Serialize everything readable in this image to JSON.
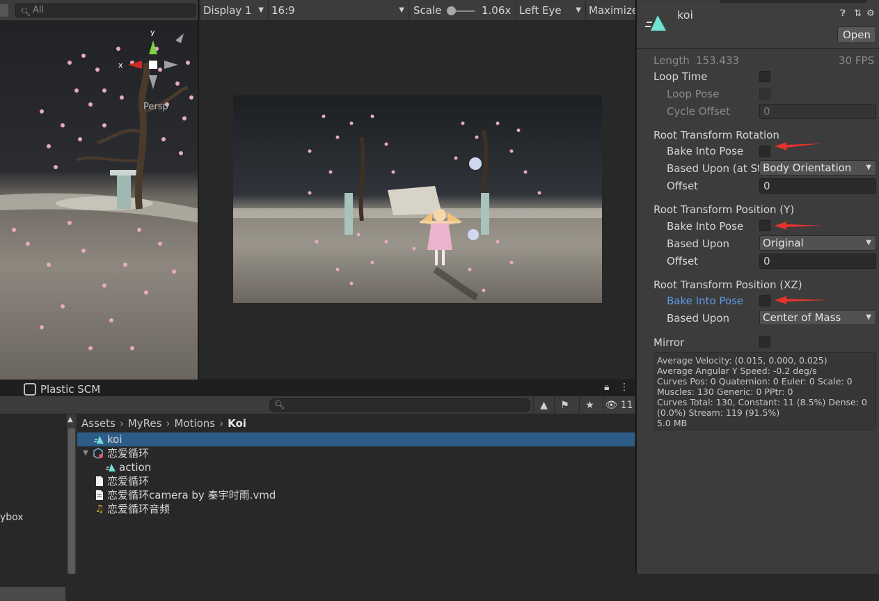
{
  "scene": {
    "search_placeholder": "All",
    "gizmo": {
      "x_label": "x",
      "y_label": "y",
      "persp_label": "Persp"
    }
  },
  "game": {
    "display": "Display 1",
    "aspect": "16:9",
    "scale_label": "Scale",
    "scale_value": "1.06x",
    "eye": "Left Eye",
    "maximize": "Maximize"
  },
  "project": {
    "tab_label": "Plastic SCM",
    "hidden_count": "11",
    "breadcrumb": [
      "Assets",
      "MyRes",
      "Motions",
      "Koi"
    ],
    "tree_items": [
      "ybox"
    ],
    "files": [
      {
        "label": "koi",
        "icon": "animation-clip-icon",
        "selected": true
      },
      {
        "label": "恋爱循环",
        "icon": "model-prefab-icon",
        "selected": false
      },
      {
        "label": "action",
        "icon": "animation-clip-icon",
        "selected": false
      },
      {
        "label": "恋爱循环",
        "icon": "document-icon",
        "selected": false
      },
      {
        "label": "恋爱循环camera by 秦宇时雨.vmd",
        "icon": "document-icon",
        "selected": false
      },
      {
        "label": "恋爱循环音频",
        "icon": "audio-icon",
        "selected": false
      }
    ]
  },
  "inspector": {
    "title": "koi",
    "open_button": "Open",
    "length_label": "Length",
    "length_value": "153.433",
    "fps": "30 FPS",
    "loop_time": "Loop Time",
    "loop_pose": "Loop Pose",
    "cycle_offset": "Cycle Offset",
    "cycle_offset_value": "0",
    "rotation": {
      "header": "Root Transform Rotation",
      "bake": "Bake Into Pose",
      "based_upon": "Based Upon (at St",
      "based_upon_value": "Body Orientation",
      "offset": "Offset",
      "offset_value": "0"
    },
    "position_y": {
      "header": "Root Transform Position (Y)",
      "bake": "Bake Into Pose",
      "based_upon": "Based Upon",
      "based_upon_value": "Original",
      "offset": "Offset",
      "offset_value": "0"
    },
    "position_xz": {
      "header": "Root Transform Position (XZ)",
      "bake": "Bake Into Pose",
      "based_upon": "Based Upon",
      "based_upon_value": "Center of Mass"
    },
    "mirror": "Mirror",
    "stats": [
      "Average Velocity: (0.015, 0.000, 0.025)",
      "Average Angular Y Speed: -0.2 deg/s",
      "Curves Pos: 0 Quaternion: 0 Euler: 0 Scale: 0",
      "Muscles: 130 Generic: 0 PPtr: 0",
      "Curves Total: 130, Constant: 11 (8.5%) Dense: 0 (0.0%) Stream: 119 (91.5%)",
      "5.0 MB"
    ],
    "colors": {
      "arrow": "#e8332c",
      "accent": "#5c9be6",
      "selection": "#2c5d87"
    }
  }
}
